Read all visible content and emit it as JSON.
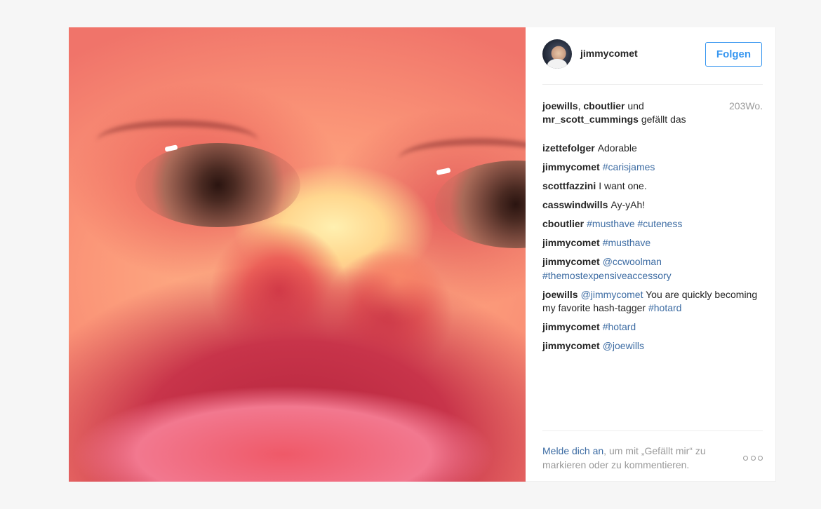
{
  "post": {
    "image_icon": "baby-face-photo"
  },
  "header": {
    "avatar_icon": "user-avatar",
    "username": "jimmycomet",
    "follow_label": "Folgen"
  },
  "likes": {
    "user1": "joewills",
    "sep1": ", ",
    "user2": "cboutlier",
    "sep2": " und",
    "user3": "mr_scott_cummings",
    "suffix": " gefällt das",
    "age": "203Wo."
  },
  "comments": [
    {
      "user": "izettefolger",
      "text": "Adorable",
      "tags": ""
    },
    {
      "user": "jimmycomet",
      "text": "",
      "tags": "#carisjames"
    },
    {
      "user": "scottfazzini",
      "text": "I want one.",
      "tags": ""
    },
    {
      "user": "casswindwills",
      "text": "Ay-yAh!",
      "tags": ""
    },
    {
      "user": "cboutlier",
      "text": "",
      "tags": "#musthave #cuteness"
    },
    {
      "user": "jimmycomet",
      "text": "",
      "tags": "#musthave"
    },
    {
      "user": "jimmycomet",
      "text": "",
      "tags": "@ccwoolman #themostexpensiveaccessory"
    },
    {
      "user": "joewills",
      "mention": "@jimmycomet",
      "text": " You are quickly becoming my favorite hash-tagger ",
      "tags": "#hotard"
    },
    {
      "user": "jimmycomet",
      "text": "",
      "tags": "#hotard"
    },
    {
      "user": "jimmycomet",
      "text": "",
      "tags": "@joewills"
    }
  ],
  "footer": {
    "login_link": "Melde dich an",
    "login_text": ", um mit „Gefällt mir“ zu markieren oder zu kommentieren.",
    "more_icon": "more-options-icon"
  },
  "colors": {
    "accent": "#3897f0",
    "link": "#3d6ca3",
    "muted": "#999999"
  }
}
